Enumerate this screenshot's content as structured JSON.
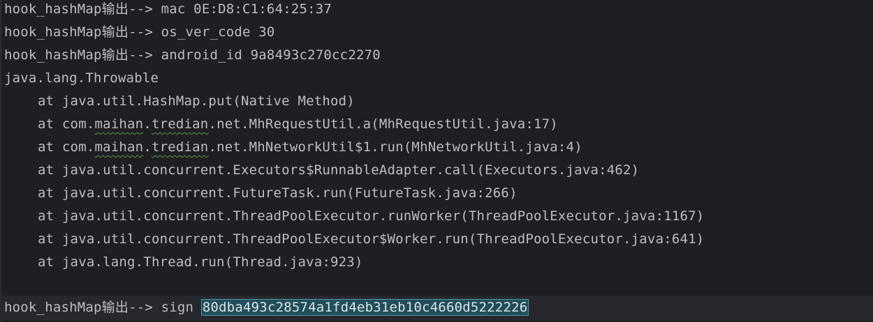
{
  "console": {
    "lines": [
      {
        "prefix": "hook_hashMap输出--> ",
        "text": "mac 0E:D8:C1:64:25:37"
      },
      {
        "prefix": "hook_hashMap输出--> ",
        "text": "os_ver_code 30"
      },
      {
        "prefix": "hook_hashMap输出--> ",
        "text": "android_id 9a8493c270cc2270"
      }
    ],
    "exception": "java.lang.Throwable",
    "stack": {
      "at": "at ",
      "f1": "java.util.HashMap.put(Native Method)",
      "f2_a": "com.",
      "f2_b": "maihan",
      "f2_c": ".",
      "f2_d": "tredian",
      "f2_e": ".net.MhRequestUtil.a(MhRequestUtil.java:17)",
      "f3_a": "com.",
      "f3_b": "maihan",
      "f3_c": ".",
      "f3_d": "tredian",
      "f3_e": ".net.MhNetworkUtil$1.run(MhNetworkUtil.java:4)",
      "f4": "java.util.concurrent.Executors$RunnableAdapter.call(Executors.java:462)",
      "f5": "java.util.concurrent.FutureTask.run(FutureTask.java:266)",
      "f6": "java.util.concurrent.ThreadPoolExecutor.runWorker(ThreadPoolExecutor.java:1167)",
      "f7": "java.util.concurrent.ThreadPoolExecutor$Worker.run(ThreadPoolExecutor.java:641)",
      "f8": "java.lang.Thread.run(Thread.java:923)"
    },
    "sign_line": {
      "prefix": "hook_hashMap输出--> ",
      "key": "sign ",
      "value": "80dba493c28574a1fd4eb31eb10c4660d5222226"
    }
  },
  "colors": {
    "background": "#1e1f22",
    "text": "#bcbec4",
    "selection": "#1f4f5a",
    "typo_underline": "#5f8f4e"
  }
}
